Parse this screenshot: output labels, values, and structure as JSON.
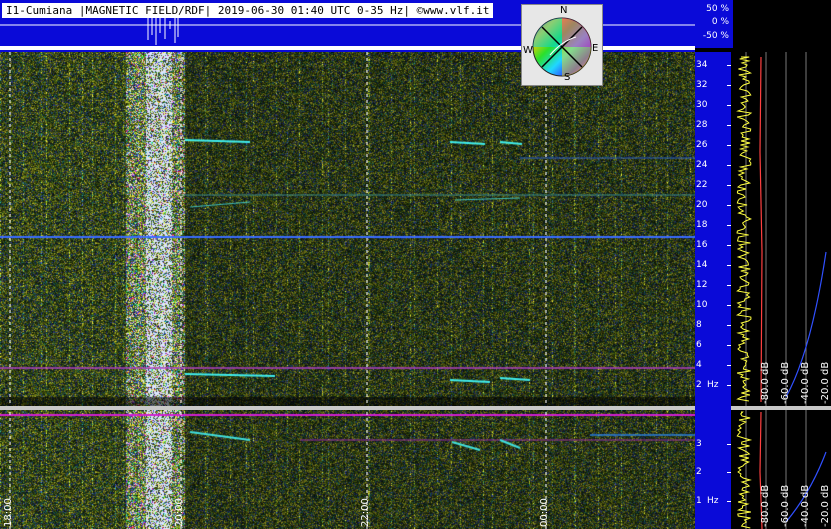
{
  "title": "I1-Cumiana |MAGNETIC FIELD/RDF| 2019-06-30 01:40 UTC 0-35 Hz| ©www.vlf.it",
  "percent_labels": [
    "50 %",
    "0 %",
    "-50 %"
  ],
  "compass": {
    "n": "N",
    "e": "E",
    "s": "S",
    "w": "W"
  },
  "colors": {
    "band": "#0a0ad8",
    "gridline": "#ffffff",
    "magenta": "#d21fd2",
    "cyan": "#2fe0e0"
  },
  "chart_data": [
    {
      "type": "heatmap",
      "title": "",
      "xlabel": "",
      "ylabel": "",
      "y_unit_label": "Hz",
      "ylim": [
        0,
        35
      ],
      "y_ticks": [
        "2",
        "4",
        "6",
        "8",
        "10",
        "12",
        "14",
        "16",
        "18",
        "20",
        "22",
        "24",
        "26",
        "28",
        "30",
        "32",
        "34"
      ],
      "x_ticks": [
        "18:00",
        "20:00",
        "22:00",
        "00:00"
      ],
      "grid": true
    },
    {
      "type": "heatmap",
      "title": "",
      "xlabel": "",
      "ylabel": "",
      "y_unit_label": "Hz",
      "ylim": [
        0,
        4
      ],
      "y_ticks": [
        "1",
        "2",
        "3"
      ],
      "x_ticks": [
        "18:00",
        "20:00",
        "22:00",
        "00:00"
      ],
      "grid": true
    }
  ],
  "level_labels_top": [
    "-80.0 dB",
    "-60.0 dB",
    "-40.0 dB",
    "-20.0 dB"
  ],
  "level_labels_bottom": [
    "-80.0 dB",
    "-60.0 dB",
    "-40.0 dB",
    "-20.0 dB"
  ]
}
